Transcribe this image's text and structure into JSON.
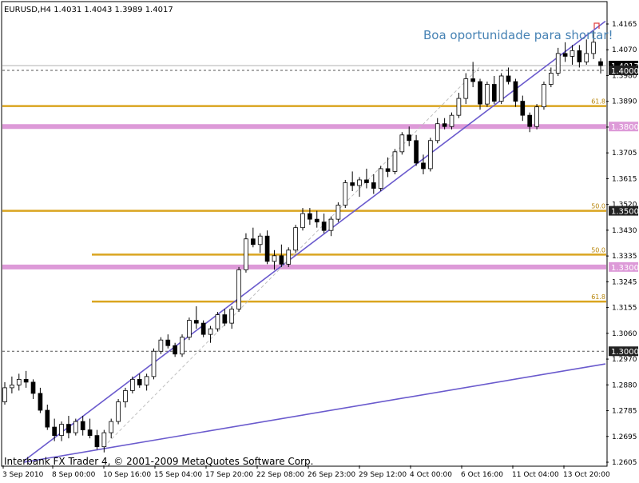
{
  "chart_data": {
    "type": "candlestick",
    "symbol_header": "EURUSD,H4  1.4031 1.4043 1.3989 1.4017",
    "annotation": "Boa oportunidade para shortar!",
    "watermark": "Interbank FX Trader 4, © 2001-2009 MetaQuotes Software Corp.",
    "y_ticks": [
      "1.4165",
      "1.4070",
      "1.3980",
      "1.3890",
      "1.3800",
      "1.3705",
      "1.3615",
      "1.3520",
      "1.3430",
      "1.3335",
      "1.3245",
      "1.3155",
      "1.3060",
      "1.2970",
      "1.2880",
      "1.2785",
      "1.2695",
      "1.2605"
    ],
    "ylim": [
      1.2605,
      1.4165
    ],
    "x_labels": [
      "3 Sep 2010",
      "8 Sep 00:00",
      "10 Sep 16:00",
      "15 Sep 04:00",
      "17 Sep 20:00",
      "22 Sep 08:00",
      "26 Sep 23:00",
      "29 Sep 12:00",
      "4 Oct 00:00",
      "6 Oct 16:00",
      "11 Oct 04:00",
      "13 Oct 20:00"
    ],
    "price_boxes": [
      {
        "label": "1.4017",
        "value": 1.4017,
        "style": "current"
      },
      {
        "label": "1.4000",
        "value": 1.4,
        "style": "dark"
      },
      {
        "label": "1.3800",
        "value": 1.38,
        "style": "pink"
      },
      {
        "label": "1.3500",
        "value": 1.35,
        "style": "dark"
      },
      {
        "label": "1.3300",
        "value": 1.33,
        "style": "pink"
      },
      {
        "label": "1.3000",
        "value": 1.3,
        "style": "dark"
      }
    ],
    "fib_levels": [
      {
        "label": "61.8",
        "value": 1.3873
      },
      {
        "label": "50.0",
        "value": 1.35
      },
      {
        "label": "50.0",
        "value": 1.3344
      },
      {
        "label": "61.8",
        "value": 1.3177
      }
    ],
    "pink_levels": [
      1.38,
      1.33
    ],
    "dashed_levels": [
      1.4,
      1.3
    ],
    "grey_level": 1.4017,
    "ohlc": [
      [
        1.282,
        1.289,
        1.281,
        1.287
      ],
      [
        1.287,
        1.291,
        1.285,
        1.288
      ],
      [
        1.288,
        1.292,
        1.286,
        1.29
      ],
      [
        1.29,
        1.293,
        1.287,
        1.289
      ],
      [
        1.289,
        1.29,
        1.283,
        1.285
      ],
      [
        1.285,
        1.287,
        1.278,
        1.279
      ],
      [
        1.279,
        1.281,
        1.272,
        1.273
      ],
      [
        1.273,
        1.276,
        1.268,
        1.27
      ],
      [
        1.27,
        1.275,
        1.268,
        1.274
      ],
      [
        1.274,
        1.277,
        1.269,
        1.271
      ],
      [
        1.271,
        1.276,
        1.27,
        1.275
      ],
      [
        1.275,
        1.277,
        1.27,
        1.272
      ],
      [
        1.272,
        1.276,
        1.269,
        1.27
      ],
      [
        1.27,
        1.272,
        1.265,
        1.266
      ],
      [
        1.266,
        1.272,
        1.264,
        1.271
      ],
      [
        1.271,
        1.276,
        1.269,
        1.275
      ],
      [
        1.275,
        1.283,
        1.274,
        1.282
      ],
      [
        1.282,
        1.287,
        1.28,
        1.286
      ],
      [
        1.286,
        1.291,
        1.285,
        1.29
      ],
      [
        1.29,
        1.292,
        1.287,
        1.288
      ],
      [
        1.288,
        1.292,
        1.286,
        1.291
      ],
      [
        1.291,
        1.301,
        1.29,
        1.3
      ],
      [
        1.3,
        1.305,
        1.299,
        1.304
      ],
      [
        1.304,
        1.306,
        1.301,
        1.302
      ],
      [
        1.302,
        1.303,
        1.298,
        1.299
      ],
      [
        1.299,
        1.306,
        1.298,
        1.305
      ],
      [
        1.305,
        1.312,
        1.304,
        1.311
      ],
      [
        1.311,
        1.316,
        1.308,
        1.31
      ],
      [
        1.31,
        1.311,
        1.305,
        1.306
      ],
      [
        1.306,
        1.309,
        1.303,
        1.308
      ],
      [
        1.308,
        1.314,
        1.307,
        1.313
      ],
      [
        1.313,
        1.315,
        1.309,
        1.31
      ],
      [
        1.31,
        1.316,
        1.308,
        1.315
      ],
      [
        1.315,
        1.33,
        1.314,
        1.329
      ],
      [
        1.329,
        1.342,
        1.328,
        1.34
      ],
      [
        1.34,
        1.344,
        1.337,
        1.338
      ],
      [
        1.338,
        1.342,
        1.335,
        1.341
      ],
      [
        1.341,
        1.343,
        1.331,
        1.332
      ],
      [
        1.332,
        1.336,
        1.329,
        1.334
      ],
      [
        1.334,
        1.338,
        1.33,
        1.331
      ],
      [
        1.331,
        1.337,
        1.33,
        1.336
      ],
      [
        1.336,
        1.345,
        1.335,
        1.344
      ],
      [
        1.344,
        1.351,
        1.343,
        1.349
      ],
      [
        1.349,
        1.351,
        1.345,
        1.347
      ],
      [
        1.347,
        1.35,
        1.344,
        1.346
      ],
      [
        1.346,
        1.349,
        1.342,
        1.343
      ],
      [
        1.343,
        1.348,
        1.341,
        1.347
      ],
      [
        1.347,
        1.353,
        1.346,
        1.352
      ],
      [
        1.352,
        1.361,
        1.351,
        1.36
      ],
      [
        1.36,
        1.364,
        1.357,
        1.359
      ],
      [
        1.359,
        1.362,
        1.355,
        1.361
      ],
      [
        1.361,
        1.365,
        1.358,
        1.36
      ],
      [
        1.36,
        1.363,
        1.356,
        1.358
      ],
      [
        1.358,
        1.366,
        1.357,
        1.365
      ],
      [
        1.365,
        1.369,
        1.362,
        1.364
      ],
      [
        1.364,
        1.372,
        1.363,
        1.371
      ],
      [
        1.371,
        1.378,
        1.37,
        1.377
      ],
      [
        1.377,
        1.38,
        1.373,
        1.375
      ],
      [
        1.375,
        1.377,
        1.366,
        1.367
      ],
      [
        1.367,
        1.37,
        1.363,
        1.365
      ],
      [
        1.365,
        1.376,
        1.364,
        1.375
      ],
      [
        1.375,
        1.383,
        1.374,
        1.381
      ],
      [
        1.381,
        1.383,
        1.379,
        1.38
      ],
      [
        1.38,
        1.385,
        1.379,
        1.384
      ],
      [
        1.384,
        1.392,
        1.383,
        1.39
      ],
      [
        1.39,
        1.399,
        1.388,
        1.397
      ],
      [
        1.397,
        1.403,
        1.394,
        1.396
      ],
      [
        1.396,
        1.397,
        1.386,
        1.388
      ],
      [
        1.388,
        1.396,
        1.387,
        1.395
      ],
      [
        1.395,
        1.398,
        1.388,
        1.389
      ],
      [
        1.389,
        1.399,
        1.388,
        1.398
      ],
      [
        1.398,
        1.401,
        1.395,
        1.396
      ],
      [
        1.396,
        1.397,
        1.387,
        1.389
      ],
      [
        1.389,
        1.391,
        1.382,
        1.384
      ],
      [
        1.384,
        1.385,
        1.378,
        1.38
      ],
      [
        1.38,
        1.388,
        1.379,
        1.387
      ],
      [
        1.387,
        1.396,
        1.386,
        1.395
      ],
      [
        1.395,
        1.401,
        1.394,
        1.399
      ],
      [
        1.399,
        1.408,
        1.398,
        1.406
      ],
      [
        1.406,
        1.41,
        1.403,
        1.405
      ],
      [
        1.405,
        1.409,
        1.402,
        1.407
      ],
      [
        1.407,
        1.409,
        1.401,
        1.403
      ],
      [
        1.403,
        1.411,
        1.402,
        1.406
      ],
      [
        1.406,
        1.414,
        1.404,
        1.41
      ],
      [
        1.4031,
        1.4043,
        1.3989,
        1.4017
      ]
    ]
  }
}
